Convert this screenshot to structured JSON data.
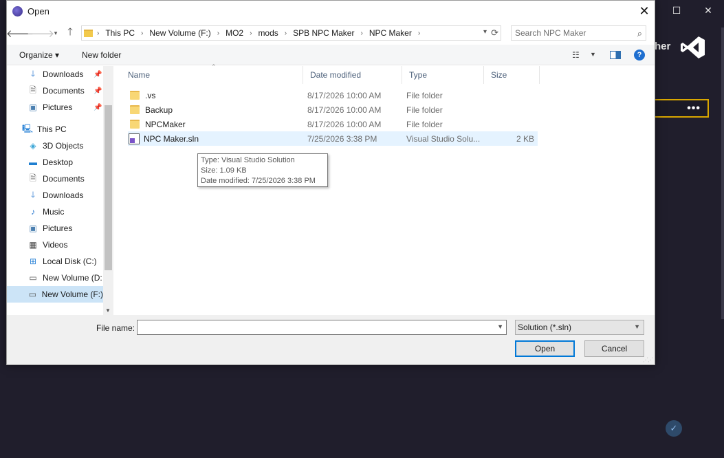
{
  "dialog": {
    "title": "Open",
    "close_glyph": "✕"
  },
  "address": {
    "crumbs": [
      "This PC",
      "New Volume (F:)",
      "MO2",
      "mods",
      "SPB NPC Maker",
      "NPC Maker"
    ],
    "search_placeholder": "Search NPC Maker"
  },
  "toolbar": {
    "organize_label": "Organize ▾",
    "new_folder_label": "New folder",
    "help_label": "?"
  },
  "nav": {
    "quick_access": [
      {
        "label": "Downloads",
        "icon": "download-arrow-icon"
      },
      {
        "label": "Documents",
        "icon": "document-icon"
      },
      {
        "label": "Pictures",
        "icon": "picture-icon"
      }
    ],
    "this_pc_label": "This PC",
    "this_pc_items": [
      {
        "label": "3D Objects",
        "icon": "cube-icon"
      },
      {
        "label": "Desktop",
        "icon": "desktop-icon"
      },
      {
        "label": "Documents",
        "icon": "document-icon"
      },
      {
        "label": "Downloads",
        "icon": "download-arrow-icon"
      },
      {
        "label": "Music",
        "icon": "music-note-icon"
      },
      {
        "label": "Pictures",
        "icon": "picture-icon"
      },
      {
        "label": "Videos",
        "icon": "film-icon"
      },
      {
        "label": "Local Disk (C:)",
        "icon": "drive-icon"
      },
      {
        "label": "New Volume (D:",
        "icon": "drive-icon"
      },
      {
        "label": "New Volume (F:)",
        "icon": "drive-icon",
        "selected": true
      }
    ]
  },
  "columns": {
    "name": "Name",
    "date": "Date modified",
    "type": "Type",
    "size": "Size"
  },
  "files": [
    {
      "name": ".vs",
      "date": "8/17/2026 10:00 AM",
      "type": "File folder",
      "size": "",
      "icon": "folder-icon"
    },
    {
      "name": "Backup",
      "date": "8/17/2026 10:00 AM",
      "type": "File folder",
      "size": "",
      "icon": "folder-icon"
    },
    {
      "name": "NPCMaker",
      "date": "8/17/2026 10:00 AM",
      "type": "File folder",
      "size": "",
      "icon": "folder-icon"
    },
    {
      "name": "NPC Maker.sln",
      "date": "7/25/2026 3:38 PM",
      "type": "Visual Studio Solu...",
      "size": "2 KB",
      "icon": "vs-solution-icon"
    }
  ],
  "tooltip": {
    "type_line": "Type: Visual Studio Solution",
    "size_line": "Size: 1.09 KB",
    "date_line": "Date modified: 7/25/2026 3:38 PM"
  },
  "bottom": {
    "file_name_label": "File name:",
    "file_name_value": "",
    "filter_value": "Solution (*.sln)",
    "open_label": "Open",
    "cancel_label": "Cancel"
  },
  "background_app": {
    "logo_text_fragment": "her",
    "more_glyph": "•••",
    "colors": {
      "accent": "#d9a700",
      "bg": "#201e2c",
      "selection": "#cce4f7",
      "link_blue": "#0078d7"
    }
  }
}
